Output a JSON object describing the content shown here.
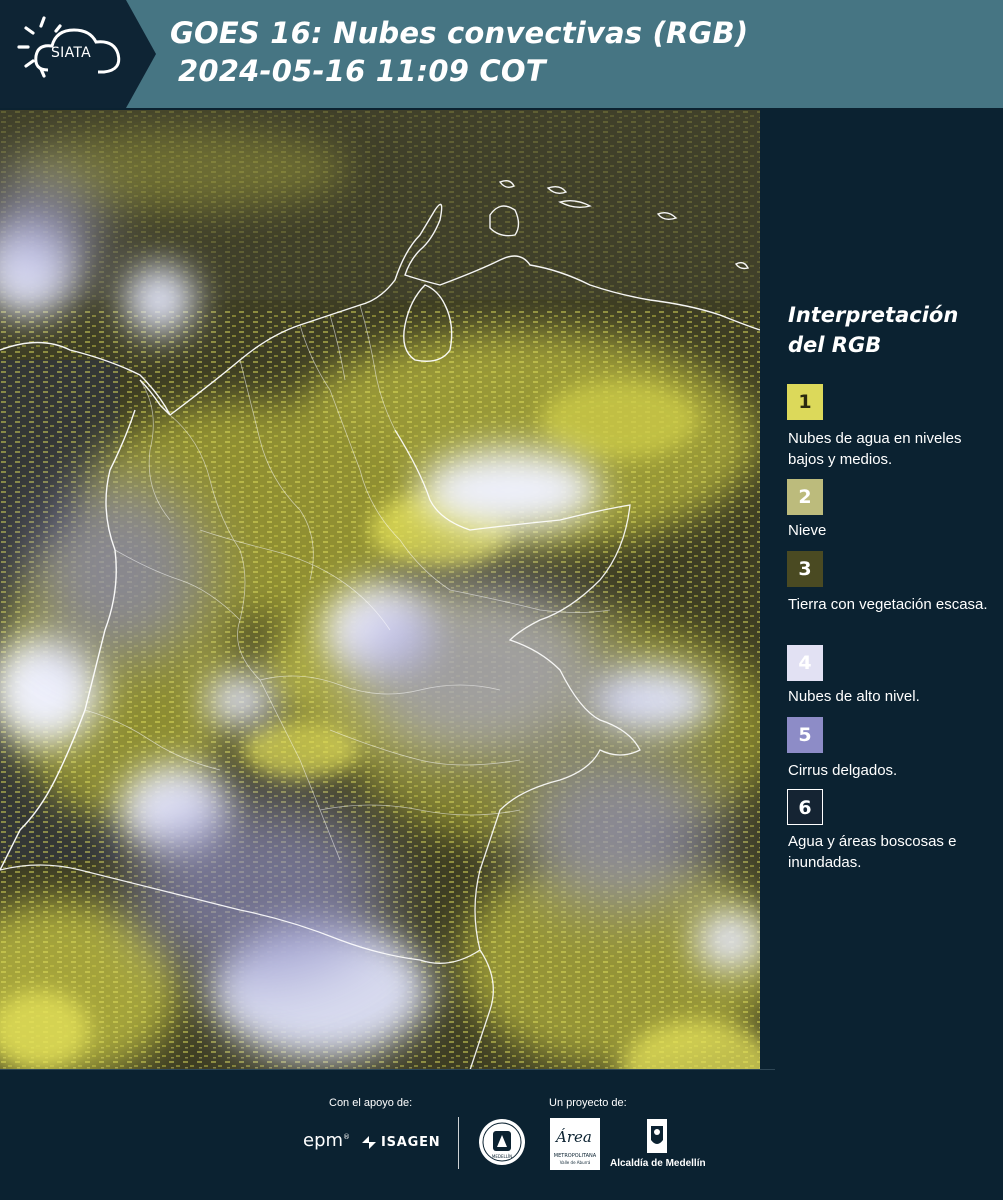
{
  "header": {
    "logo_text": "SIATA",
    "title_line1": "GOES 16: Nubes convectivas (RGB)",
    "title_line2": "2024-05-16 11:09 COT",
    "background_color": "#467583"
  },
  "map": {
    "description_colors": {
      "background_dark_land": "#3d3d24",
      "low_mid_clouds": "#d6d548",
      "high_clouds": "#dde0f2",
      "border_lines": "#ffffff"
    }
  },
  "legend": {
    "title_line1": "Interpretación",
    "title_line2": "del RGB",
    "items": [
      {
        "number": "1",
        "color": "#dcd95a",
        "text_color": "#2a2a10",
        "label": "Nubes de agua en niveles bajos y medios."
      },
      {
        "number": "2",
        "color": "#bcbb7c",
        "text_color": "#ffffff",
        "label": "Nieve"
      },
      {
        "number": "3",
        "color": "#4a4a22",
        "text_color": "#ffffff",
        "label": "Tierra con vegetación escasa."
      },
      {
        "number": "4",
        "color": "#e2e1f3",
        "text_color": "#ffffff",
        "label": "Nubes de alto nivel."
      },
      {
        "number": "5",
        "color": "#8d8cc7",
        "text_color": "#ffffff",
        "label": "Cirrus delgados."
      },
      {
        "number": "6",
        "color": "#152433",
        "text_color": "#ffffff",
        "label": "Agua y áreas boscosas e inundadas."
      }
    ]
  },
  "footer": {
    "support_label": "Con el apoyo de:",
    "project_label": "Un proyecto de:",
    "sponsors": [
      "epm",
      "ISAGEN"
    ],
    "partners": [
      "Área Metropolitana Valle de Aburrá",
      "Alcaldía de Medellín"
    ],
    "partner_seal_text": "MEDELLÍN",
    "area_logo_text": "Área",
    "area_logo_subtext": "METROPOLITANA",
    "area_logo_subtext2": "Valle de Aburrá"
  }
}
